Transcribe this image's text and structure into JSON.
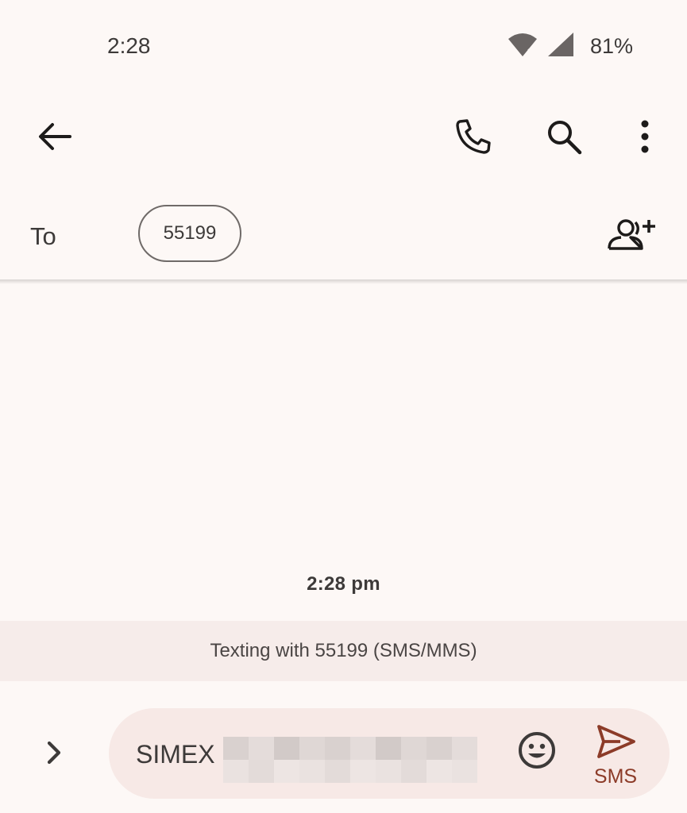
{
  "status_bar": {
    "time": "2:28",
    "battery": "81%",
    "icons": [
      "wifi-icon",
      "signal-icon"
    ]
  },
  "top_bar": {
    "icons": [
      "back-arrow-icon",
      "phone-icon",
      "search-icon",
      "more-vert-icon"
    ]
  },
  "recipient": {
    "to_label": "To",
    "chip": "55199",
    "add_icon": "add-person-icon"
  },
  "conversation": {
    "timestamp": "2:28 pm"
  },
  "banner": {
    "text": "Texting with 55199 (SMS/MMS)"
  },
  "compose": {
    "value": "SIMEX",
    "expand_icon": "chevron-right-icon",
    "emoji_icon": "emoji-icon",
    "send_icon": "send-icon",
    "send_label": "SMS"
  },
  "colors": {
    "background": "#fdf8f6",
    "banner": "#f6ecea",
    "compose_field": "#f7e9e6",
    "accent": "#8c3b28"
  }
}
